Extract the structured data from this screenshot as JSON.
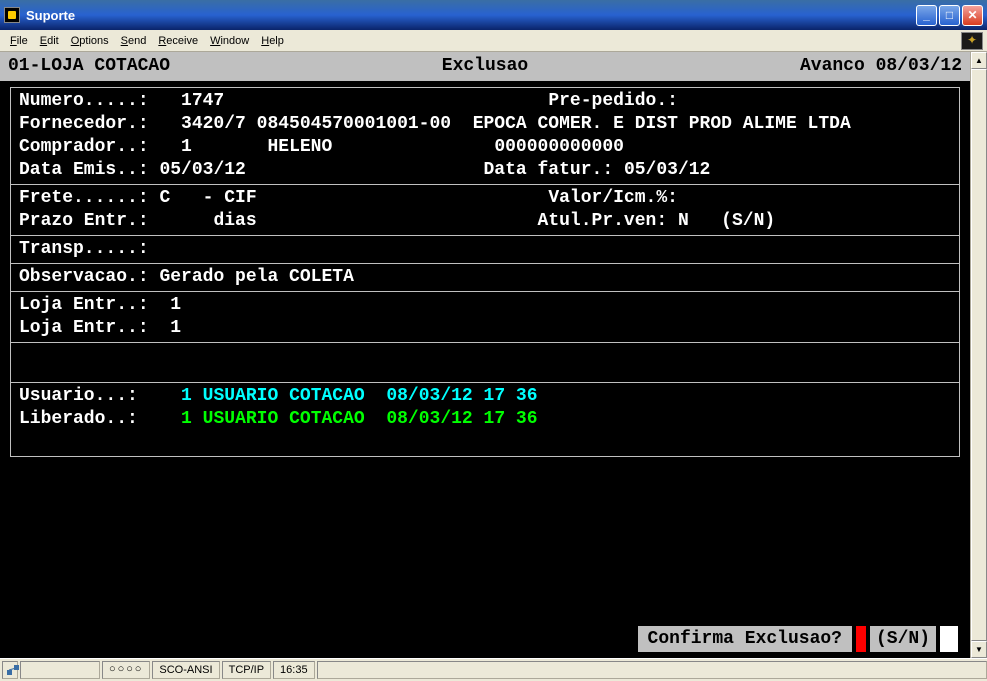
{
  "window": {
    "title": "Suporte"
  },
  "menu": {
    "file": "File",
    "edit": "Edit",
    "options": "Options",
    "send": "Send",
    "receive": "Receive",
    "window": "Window",
    "help": "Help"
  },
  "terminal": {
    "header": {
      "left": "01-LOJA COTACAO",
      "center": "Exclusao",
      "right": "Avanco 08/03/12"
    },
    "section1": {
      "numero_label": "Numero.....:",
      "numero": "1747",
      "prepedido_label": "Pre-pedido.:",
      "prepedido": "",
      "fornecedor_label": "Fornecedor.:",
      "fornecedor_code": "3420/7 084504570001001-00",
      "fornecedor_name": "EPOCA COMER. E DIST PROD ALIME LTDA",
      "comprador_label": "Comprador..:",
      "comprador_num": "1",
      "comprador_name": "HELENO",
      "comprador_code": "000000000000",
      "dataemis_label": "Data Emis..:",
      "dataemis": "05/03/12",
      "datafatur_label": "Data fatur.:",
      "datafatur": "05/03/12"
    },
    "section2": {
      "frete_label": "Frete......:",
      "frete": "C   - CIF",
      "valoricm_label": "Valor/Icm.%:",
      "prazo_label": "Prazo Entr.:",
      "prazo": "dias",
      "atulpr_label": "Atul.Pr.ven:",
      "atulpr": "N   (S/N)"
    },
    "section3": {
      "transp_label": "Transp.....:",
      "transp": ""
    },
    "section4": {
      "obs_label": "Observacao.:",
      "obs": "Gerado pela COLETA"
    },
    "section5": {
      "loja1_label": "Loja Entr..:",
      "loja1": "1",
      "loja2_label": "Loja Entr..:",
      "loja2": "1"
    },
    "section6": {
      "usuario_label": "Usuario...:",
      "usuario_num": "1",
      "usuario_name": "USUARIO COTACAO",
      "usuario_datetime": "08/03/12 17 36",
      "liberado_label": "Liberado..:",
      "liberado_num": "1",
      "liberado_name": "USUARIO COTACAO",
      "liberado_datetime": "08/03/12 17 36"
    },
    "confirm": {
      "text": "Confirma Exclusao?",
      "sn": "(S/N)"
    }
  },
  "status": {
    "dots": "○○○○",
    "protocol": "SCO-ANSI",
    "conn": "TCP/IP",
    "time": "16:35"
  }
}
